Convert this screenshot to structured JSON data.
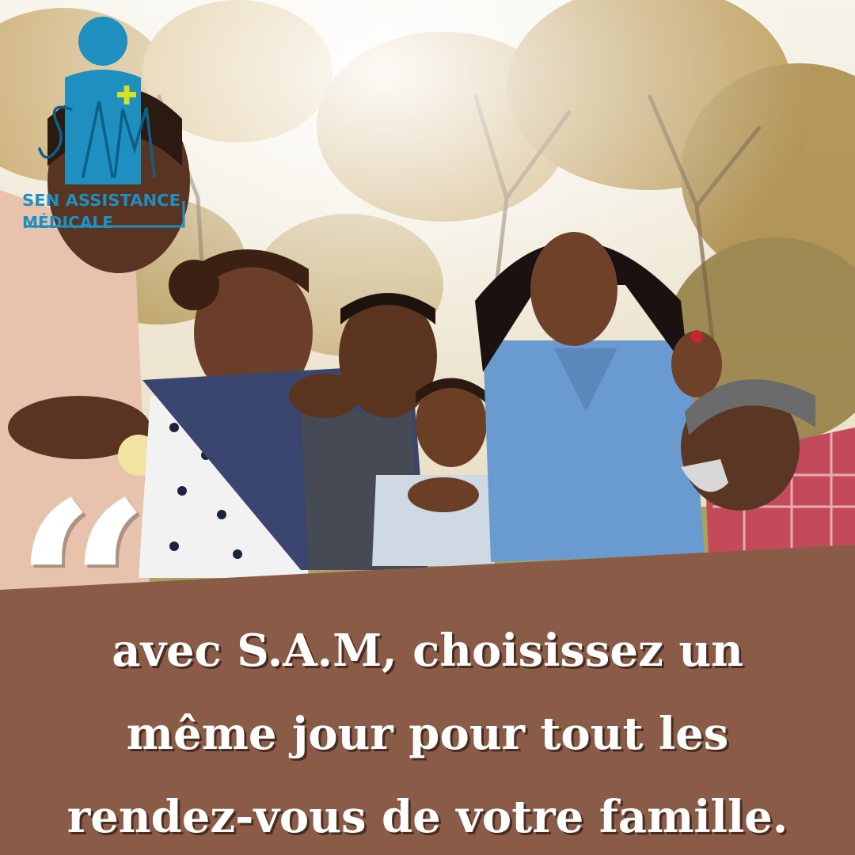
{
  "logo": {
    "initials": "SAM",
    "brand_line1": "SEN ASSISTANCE",
    "brand_line2": "MÉDICALE",
    "colors": {
      "primary": "#1e8fbf",
      "accent_plus": "#d6e020"
    }
  },
  "quote": {
    "mark": "“",
    "lines": [
      "avec S.A.M, choisissez un",
      "même jour pour tout les",
      "rendez-vous de votre famille."
    ]
  },
  "colors": {
    "panel": "#8a5c47",
    "text": "#ffffff",
    "shadow": "#4a2c20"
  },
  "photo": {
    "subject": "family-picnic-photo"
  }
}
